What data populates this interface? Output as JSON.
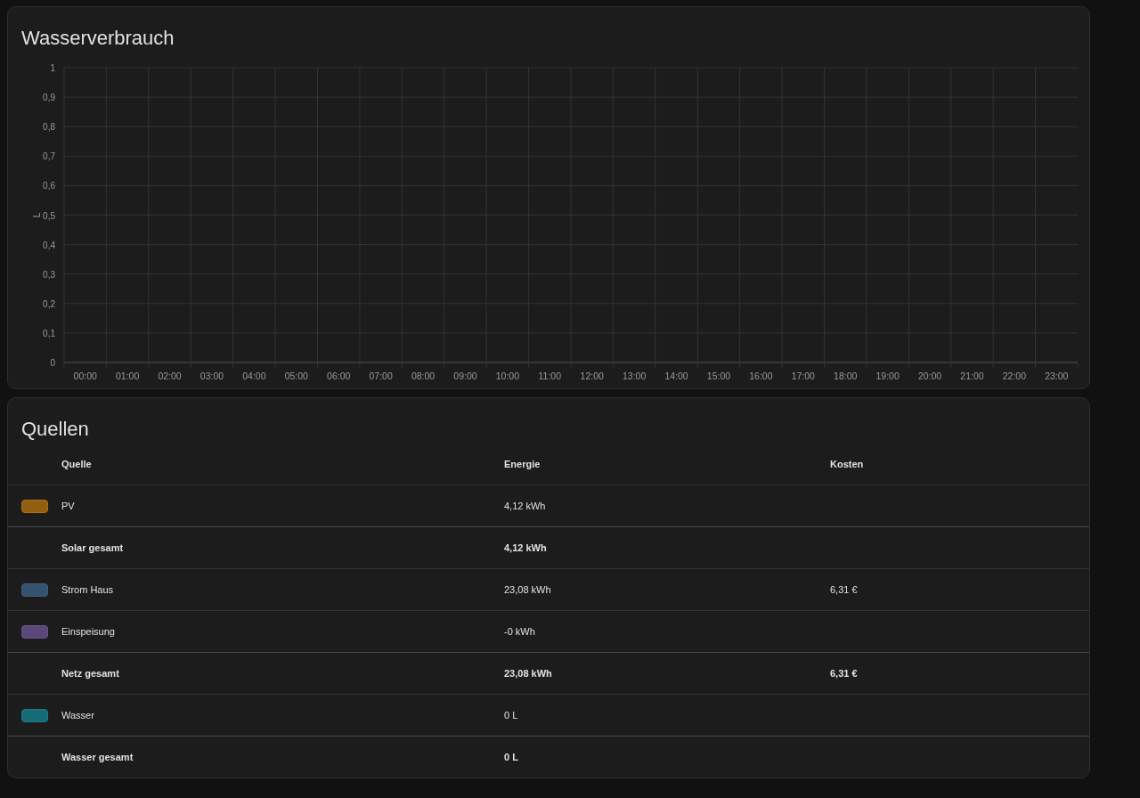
{
  "chart_card": {
    "title": "Wasserverbrauch",
    "chart_data": {
      "type": "bar",
      "ylabel": "L",
      "categories": [
        "00:00",
        "01:00",
        "02:00",
        "03:00",
        "04:00",
        "05:00",
        "06:00",
        "07:00",
        "08:00",
        "09:00",
        "10:00",
        "11:00",
        "12:00",
        "13:00",
        "14:00",
        "15:00",
        "16:00",
        "17:00",
        "18:00",
        "19:00",
        "20:00",
        "21:00",
        "22:00",
        "23:00"
      ],
      "grid": true,
      "ylim": [
        0,
        1
      ],
      "yticks": [
        {
          "value": 0,
          "label": "0"
        },
        {
          "value": 0.1,
          "label": "0,1"
        },
        {
          "value": 0.2,
          "label": "0,2"
        },
        {
          "value": 0.3,
          "label": "0,3"
        },
        {
          "value": 0.4,
          "label": "0,4"
        },
        {
          "value": 0.5,
          "label": "0,5"
        },
        {
          "value": 0.6,
          "label": "0,6"
        },
        {
          "value": 0.7,
          "label": "0,7"
        },
        {
          "value": 0.8,
          "label": "0,8"
        },
        {
          "value": 0.9,
          "label": "0,9"
        },
        {
          "value": 1,
          "label": "1"
        }
      ]
    }
  },
  "sources_card": {
    "title": "Quellen",
    "columns": [
      "Quelle",
      "Energie",
      "Kosten"
    ],
    "rows": [
      {
        "kind": "source",
        "name": "PV",
        "color": "#b0710f",
        "energy": "4,12 kWh"
      },
      {
        "kind": "total",
        "name": "Solar gesamt",
        "energy": "4,12 kWh"
      },
      {
        "kind": "source",
        "name": "Strom Haus",
        "color": "#3c6183",
        "energy": "23,08 kWh",
        "cost": "6,31 €"
      },
      {
        "kind": "source",
        "name": "Einspeisung",
        "color": "#6d5490",
        "energy": "-0 kWh"
      },
      {
        "kind": "total",
        "name": "Netz gesamt",
        "energy": "23,08 kWh",
        "cost": "6,31 €"
      },
      {
        "kind": "source",
        "name": "Wasser",
        "color": "#16808f",
        "energy": "0 L"
      },
      {
        "kind": "total",
        "name": "Wasser gesamt",
        "energy": "0 L"
      }
    ]
  }
}
